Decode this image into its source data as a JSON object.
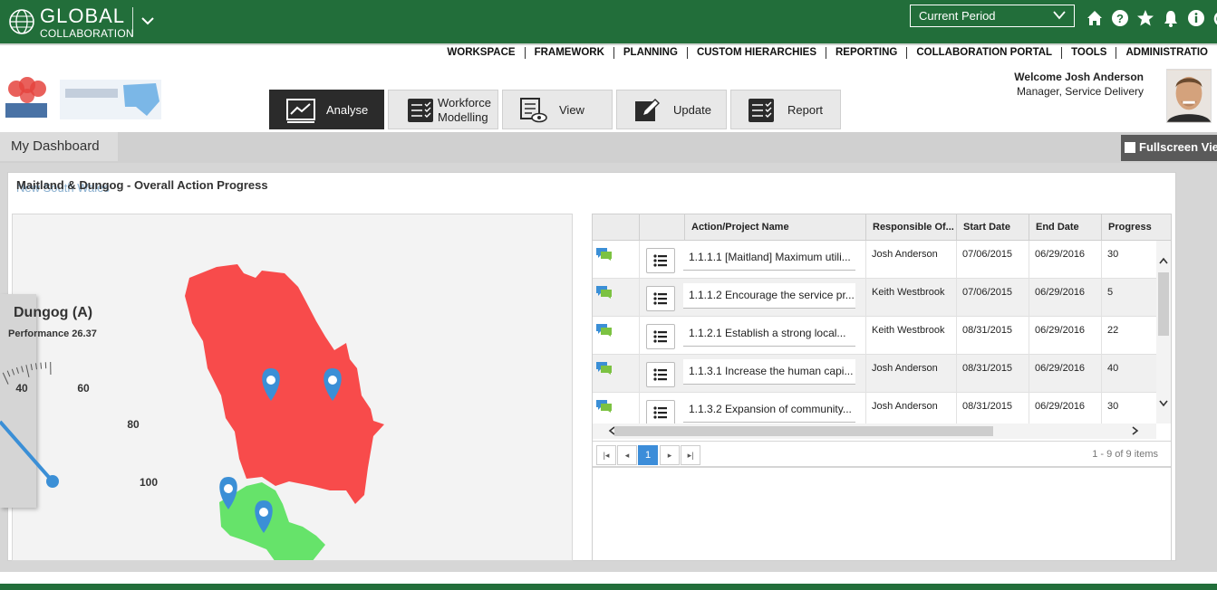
{
  "brand": {
    "line1": "GLOBAL",
    "line2": "COLLABORATION"
  },
  "period": {
    "label": "Current Period"
  },
  "top_icons": [
    "home-icon",
    "help-icon",
    "star-icon",
    "bell-icon",
    "info-icon",
    "power-icon"
  ],
  "nav": {
    "items": [
      "WORKSPACE",
      "FRAMEWORK",
      "PLANNING",
      "CUSTOM HIERARCHIES",
      "REPORTING",
      "COLLABORATION PORTAL",
      "TOOLS",
      "ADMINISTRATIO"
    ]
  },
  "tiles": {
    "analyse": "Analyse",
    "workforce_1": "Workforce",
    "workforce_2": "Modelling",
    "view": "View",
    "update": "Update",
    "report": "Report"
  },
  "user": {
    "welcome": "Welcome Josh Anderson",
    "role": "Manager, Service Delivery"
  },
  "dashboard": {
    "title": "My Dashboard",
    "fullscreen": "Fullscreen Vie"
  },
  "panel": {
    "title": "Maitland & Dungog - Overall Action Progress",
    "subtitle": "New South Wales"
  },
  "gauge": {
    "title": "Dungog (A)",
    "performance": "Performance 26.37",
    "ticks": [
      "40",
      "60",
      "80",
      "100"
    ]
  },
  "grid": {
    "headers": [
      "Action/Project Name",
      "Responsible Of...",
      "Start Date",
      "End Date",
      "Progress"
    ],
    "rows": [
      {
        "name": "1.1.1.1 [Maitland] Maximum utili...",
        "owner": "Josh Anderson",
        "start": "07/06/2015",
        "end": "06/29/2016",
        "progress": "30"
      },
      {
        "name": "1.1.1.2 Encourage the service pr...",
        "owner": "Keith Westbrook",
        "start": "07/06/2015",
        "end": "06/29/2016",
        "progress": "5"
      },
      {
        "name": "1.1.2.1 Establish a strong local...",
        "owner": "Keith Westbrook",
        "start": "08/31/2015",
        "end": "06/29/2016",
        "progress": "22"
      },
      {
        "name": "1.1.3.1 Increase the human capi...",
        "owner": "Josh Anderson",
        "start": "08/31/2015",
        "end": "06/29/2016",
        "progress": "40"
      },
      {
        "name": "1.1.3.2 Expansion of community...",
        "owner": "Josh Anderson",
        "start": "08/31/2015",
        "end": "06/29/2016",
        "progress": "30"
      }
    ],
    "page": "1",
    "info": "1 - 9 of 9 items"
  },
  "colors": {
    "brand_green": "#226e3a",
    "region_red": "#f84b4b",
    "region_green": "#66e36a",
    "pin_blue": "#3b8fd6",
    "pager_blue": "#3c8dd9"
  }
}
